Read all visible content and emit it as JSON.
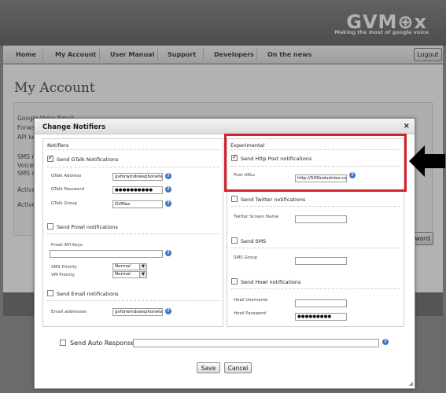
{
  "brand": {
    "logo": "GVM⊕x",
    "tagline": "Making the most of google voice"
  },
  "nav": {
    "items": [
      "Home",
      "My Account",
      "User Manual",
      "Support",
      "Developers",
      "On the news"
    ],
    "logout_label": "Logout"
  },
  "page": {
    "title": "My Account",
    "settings_labels": [
      "Google Voice Email",
      "Forwa",
      "API ke",
      "SMS re",
      "Voicen",
      "SMS s",
      "Active",
      "Active"
    ],
    "bg_button_label": "word"
  },
  "modal": {
    "title": "Change Notifiers",
    "close_label": "×",
    "notifiers": {
      "title": "Notifiers",
      "gtalk": {
        "label": "Send GTalk Notifications",
        "checked": true,
        "address_label": "GTalk Address",
        "address_value": "gvforwindowsphonetest",
        "password_label": "GTalk Password",
        "password_value": "●●●●●●●●●●",
        "group_label": "GTalk Group",
        "group_value": "GVMax"
      },
      "prowl": {
        "label": "Send Prowl notifications",
        "checked": false,
        "api_keys_label": "Prowl API Keys",
        "api_keys_value": "",
        "sms_priority_label": "SMS Priority",
        "sms_priority_value": "Normal",
        "vm_priority_label": "VM Priority",
        "vm_priority_value": "Normal"
      },
      "email": {
        "label": "Send Email notifications",
        "checked": false,
        "addresses_label": "Email addresses",
        "addresses_value": "gvforwindowsphonetest"
      }
    },
    "experimental": {
      "title": "Experimental",
      "http_post": {
        "label": "Send Http Post notifications",
        "checked": true,
        "urls_label": "Post URLs",
        "urls_value": "http://509industries.co"
      },
      "twitter": {
        "label": "Send Twitter notifications",
        "checked": false,
        "screen_name_label": "Twitter Screen Name",
        "screen_name_value": ""
      },
      "sms": {
        "label": "Send SMS",
        "checked": false,
        "group_label": "SMS Group",
        "group_value": ""
      },
      "howl": {
        "label": "Send Howl notifications",
        "checked": false,
        "username_label": "Howl Username",
        "username_value": "",
        "password_label": "Howl Password",
        "password_value": "●●●●●●●●●"
      }
    },
    "auto_response": {
      "label": "Send Auto Response",
      "checked": false,
      "value": ""
    },
    "save_label": "Save",
    "cancel_label": "Cancel",
    "info_glyph": "?"
  },
  "annotation": {
    "highlight_color": "#d2232a",
    "arrow_color": "#000000"
  }
}
